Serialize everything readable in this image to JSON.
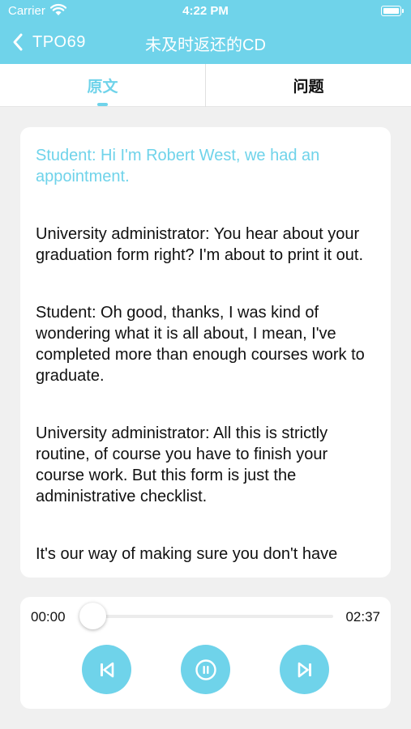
{
  "status_bar": {
    "carrier": "Carrier",
    "time": "4:22 PM"
  },
  "nav": {
    "back_label": "TPO69",
    "title": "未及时返还的CD"
  },
  "tabs": [
    {
      "label": "原文",
      "selected": true
    },
    {
      "label": "问题",
      "selected": false
    }
  ],
  "transcript": [
    {
      "text": "Student: Hi I'm Robert West, we had an appointment.",
      "active": true
    },
    {
      "text": "University administrator: You hear about your graduation form right? I'm about to print it out.",
      "active": false
    },
    {
      "text": "Student: Oh good, thanks, I was kind of wondering what it is all about, I mean, I've completed more than enough courses work to graduate.",
      "active": false
    },
    {
      "text": "University administrator: All this is strictly routine, of course you have to finish your course work. But this form is just the administrative checklist.",
      "active": false
    },
    {
      "text": "It's our way of making sure you don't have",
      "active": false
    }
  ],
  "player": {
    "current_time": "00:00",
    "total_time": "02:37",
    "progress": 0
  },
  "colors": {
    "accent": "#6fd3ea",
    "background": "#f0f0f0"
  },
  "icons": [
    "chevron-left-icon",
    "wifi-icon",
    "battery-icon",
    "skip-previous-icon",
    "pause-icon",
    "skip-next-icon"
  ]
}
